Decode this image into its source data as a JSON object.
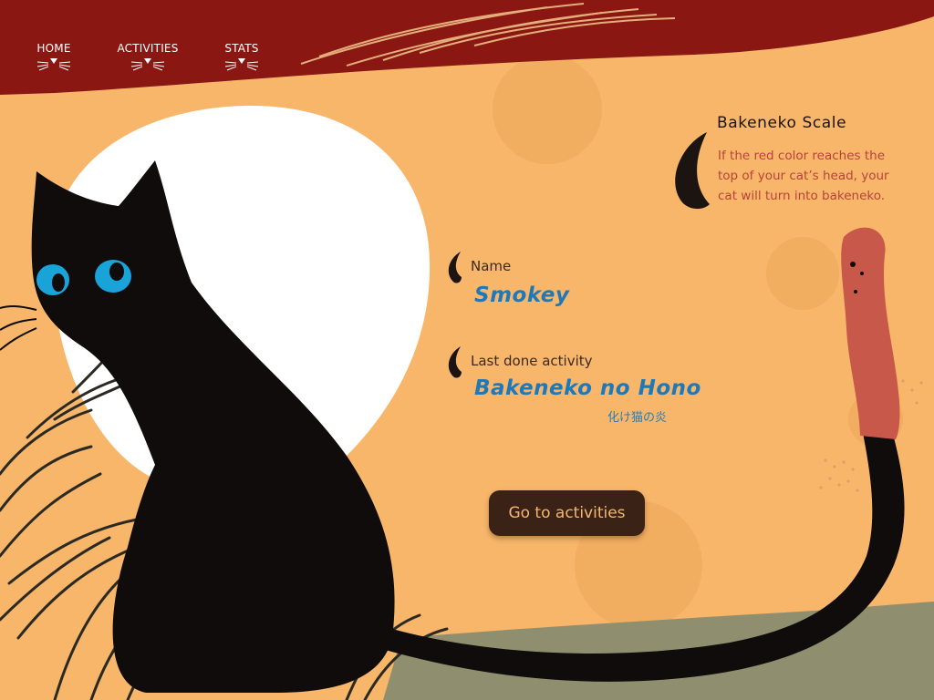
{
  "nav": {
    "items": [
      {
        "label": "HOME",
        "active": true
      },
      {
        "label": "ACTIVITIES",
        "active": false
      },
      {
        "label": "STATS",
        "active": false
      }
    ]
  },
  "cat": {
    "name_label": "Name",
    "name_value": "Smokey",
    "activity_label": "Last done activity",
    "activity_value": "Bakeneko no Hono",
    "activity_subtitle": "化け猫の炎"
  },
  "actions": {
    "go_label": "Go to activities"
  },
  "scale": {
    "title": "Bakeneko Scale",
    "description": "If the red color reaches the top of your cat’s head, your cat will turn into bakeneko.",
    "fill_fraction": 0.62
  },
  "colors": {
    "background": "#f7b66a",
    "banner": "#8a1712",
    "cat": "#0f0c0b",
    "eye": "#1aa3d8",
    "moon": "#ffffff",
    "tail_red": "#c8584a",
    "ground": "#8f8f70",
    "accent_text": "#1f78b8",
    "scale_text": "#b8433a",
    "button": "#3a2216",
    "button_text": "#f5b86c"
  }
}
